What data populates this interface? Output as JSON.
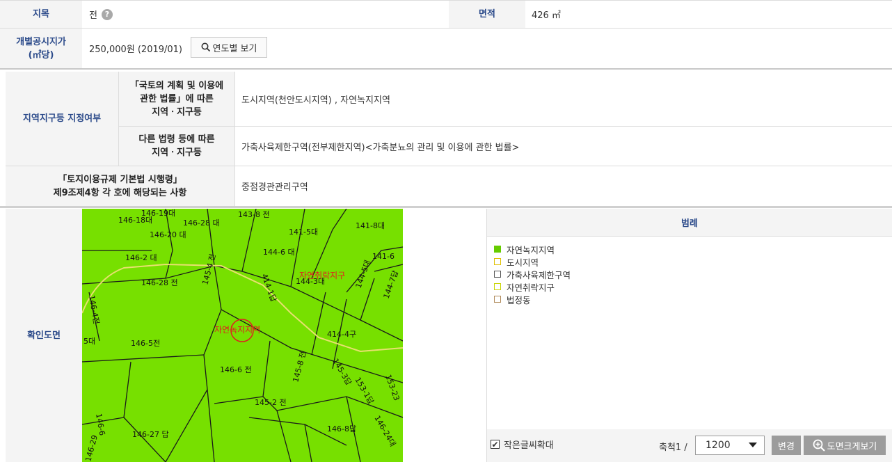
{
  "land": {
    "category_label": "지목",
    "category_value": "전",
    "help_icon": "question-icon",
    "area_label": "면적",
    "area_value": "426 ㎡",
    "price_label": "개별공시지가\n(㎡당)",
    "price_value": "250,000원 (2019/01)",
    "year_button": "연도별 보기"
  },
  "zoning": {
    "section_label": "지역지구등 지정여부",
    "national_label": "「국토의 계획 및 이용에\n관한 법률」에 따른\n지역ㆍ지구등",
    "national_value": "도시지역(천안도시지역) , 자연녹지지역",
    "other_label": "다른 법령 등에 따른\n지역ㆍ지구등",
    "other_value": "가축사육제한구역(전부제한지역)<가축분뇨의 관리 및 이용에 관한 법률>",
    "decree_label": "「토지이용규제 기본법 시행령」\n제9조제4항 각 호에 해당되는 사항",
    "decree_value": "중점경관관리구역"
  },
  "map": {
    "section_label": "확인도면",
    "zone_labels": [
      "자연취락지구",
      "자연녹지지역"
    ],
    "parcels": [
      "146-19대",
      "146-18대",
      "146-20 대",
      "146-2 대",
      "146-28 전",
      "146-4전",
      "146-5전",
      "146-6 전",
      "145-2 전",
      "145-8 전",
      "146-27 답",
      "146-8답",
      "141-5대",
      "141-8대",
      "144-6 대",
      "144-3대",
      "141-6",
      "143-8 전",
      "414-1답",
      "414-4구",
      "145-3답",
      "153-1답",
      "153-23",
      "144-5대",
      "144-7답",
      "146-24대",
      "146-29",
      "146-6",
      "146-28 대",
      "5대",
      "145-4 전"
    ]
  },
  "legend": {
    "title": "범례",
    "items": [
      {
        "label": "자연녹지지역",
        "fill": "#66cc00",
        "border": "#66cc00"
      },
      {
        "label": "도시지역",
        "fill": "#ffffff",
        "border": "#e0c000"
      },
      {
        "label": "가축사육제한구역",
        "fill": "#ffffff",
        "border": "#555555"
      },
      {
        "label": "자연취락지구",
        "fill": "#ffffff",
        "border": "#c8d400"
      },
      {
        "label": "법정동",
        "fill": "#ffffff",
        "border": "#b08a5a"
      }
    ]
  },
  "controls": {
    "enlarge_text_label": "작은글씨확대",
    "enlarge_text_checked": true,
    "scale_label": "축척1 /",
    "scale_value": "1200",
    "change_button": "변경",
    "bigmap_button": "도면크게보기"
  },
  "colors": {
    "label_blue": "#2b4a8a",
    "map_green": "#77e000",
    "button_gray": "#9c9c9c"
  }
}
